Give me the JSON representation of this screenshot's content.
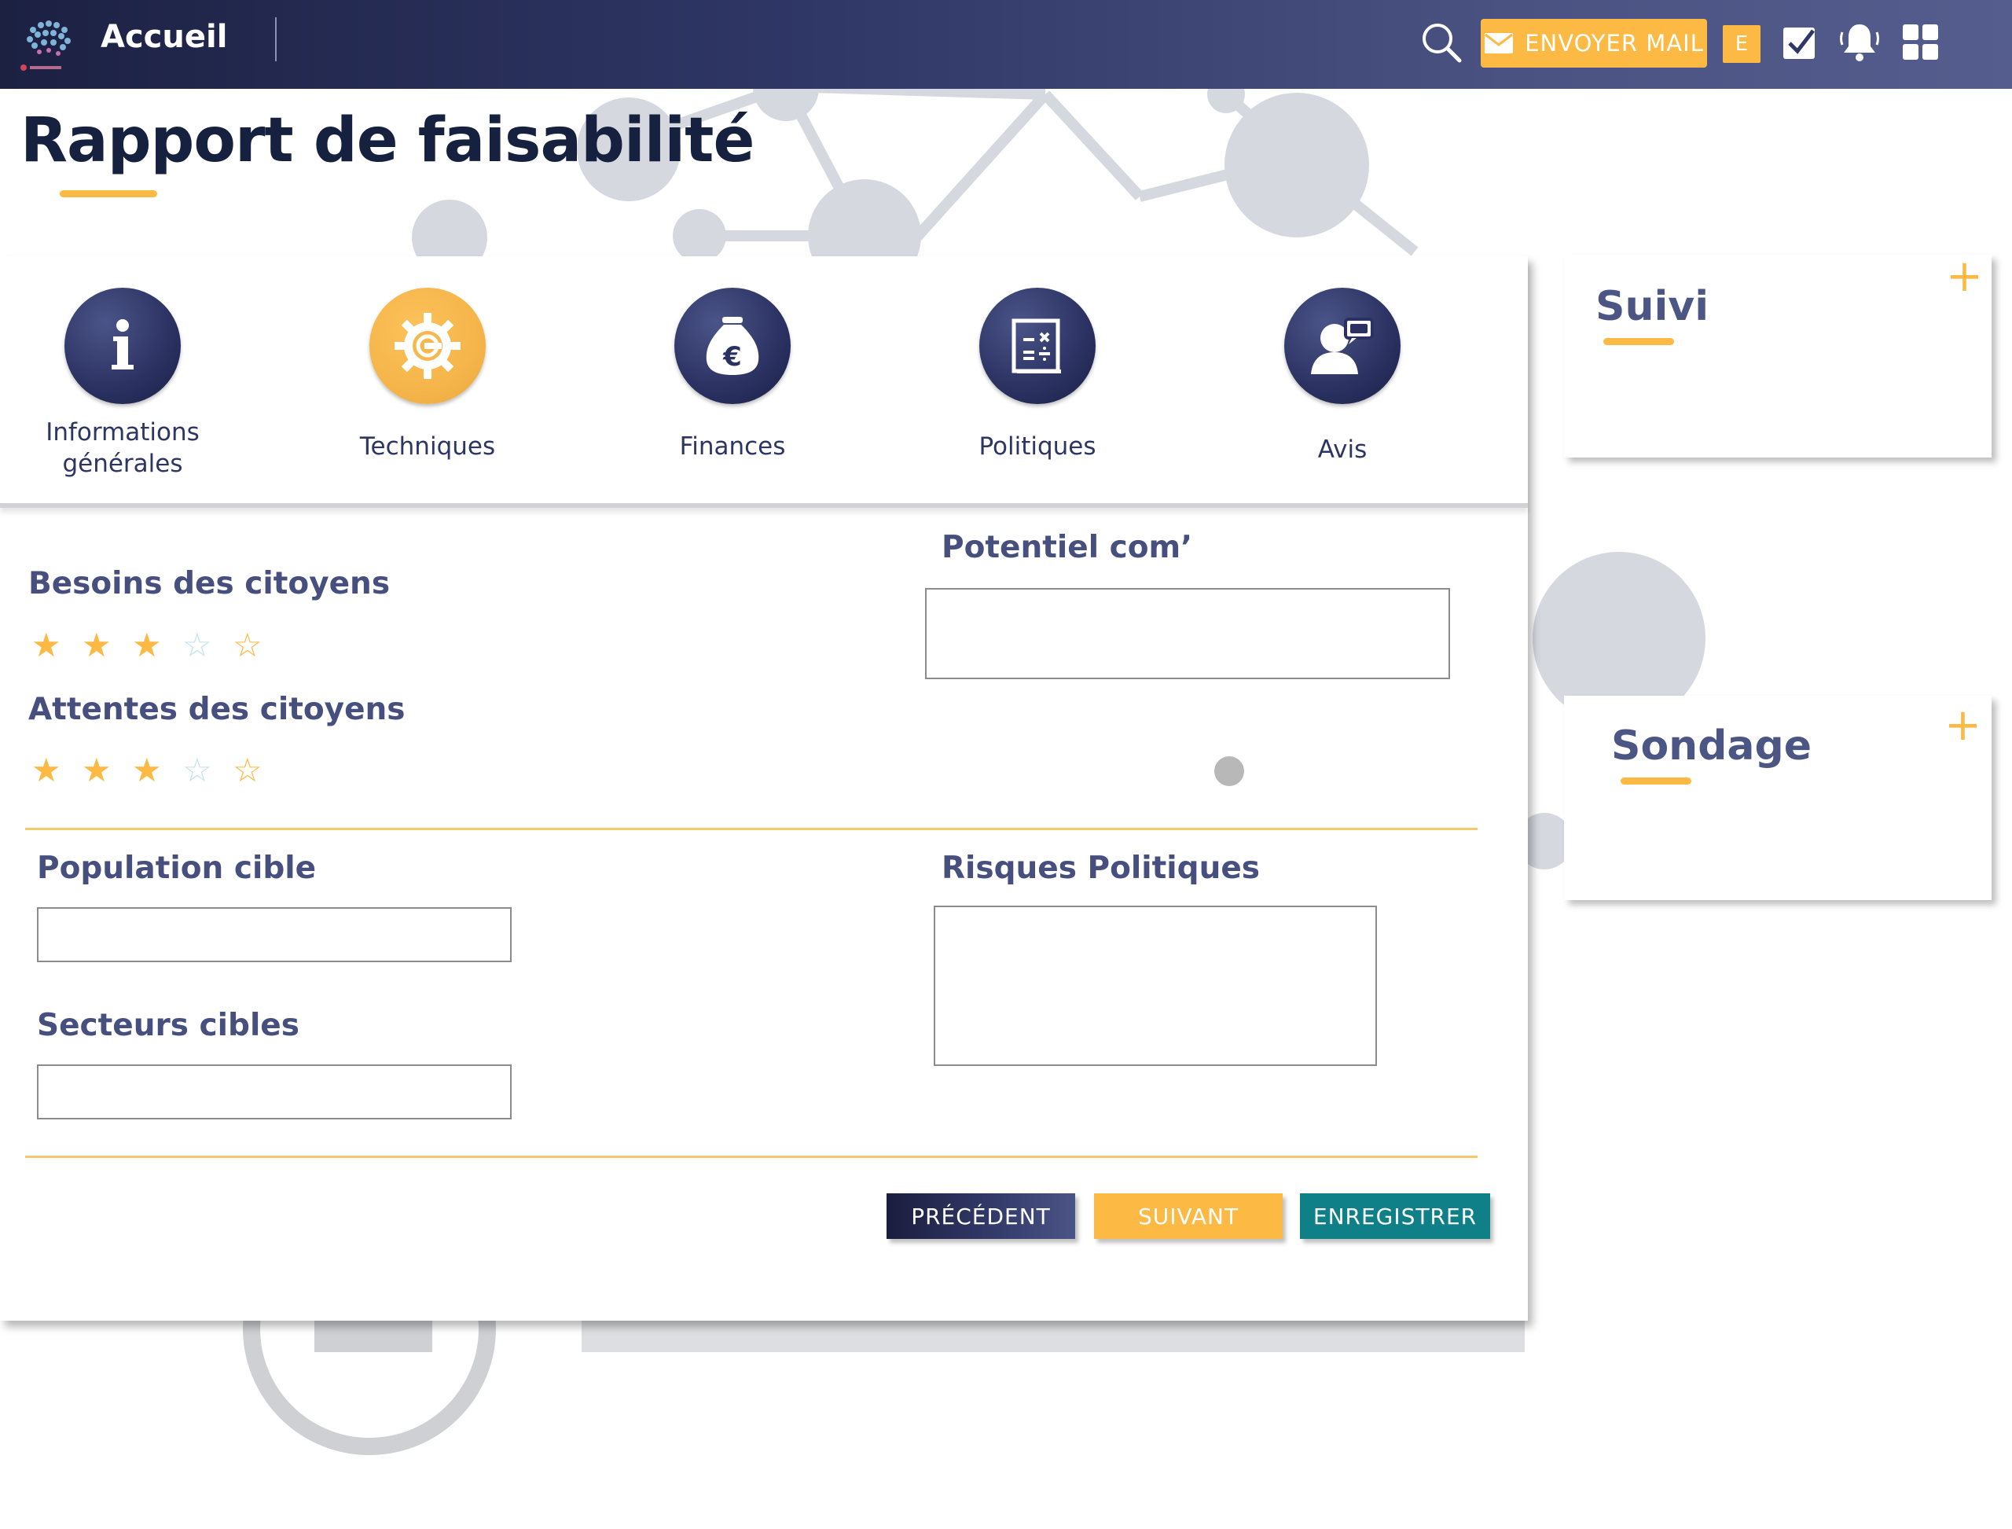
{
  "header": {
    "home_label": "Accueil",
    "mail_button": "ENVOYER  MAIL",
    "user_badge": "E"
  },
  "page": {
    "title": "Rapport de faisabilité"
  },
  "tabs": [
    {
      "label": "Informations\ngénérales",
      "icon": "info-icon",
      "active": false
    },
    {
      "label": "Techniques",
      "icon": "gear-icon",
      "active": true
    },
    {
      "label": "Finances",
      "icon": "money-bag-euro-icon",
      "active": false
    },
    {
      "label": "Politiques",
      "icon": "document-calculator-icon",
      "active": false
    },
    {
      "label": "Avis",
      "icon": "person-speech-icon",
      "active": false
    }
  ],
  "form": {
    "besoins_label": "Besoins des citoyens",
    "besoins_rating": 3,
    "attentes_label": "Attentes des citoyens",
    "attentes_rating": 3,
    "rating_max": 5,
    "potentiel_label": "Potentiel com’",
    "potentiel_value": "",
    "population_label": "Population cible",
    "population_value": "",
    "secteurs_label": "Secteurs cibles",
    "secteurs_value": "",
    "risques_label": "Risques Politiques",
    "risques_value": ""
  },
  "buttons": {
    "prev": "PRÉCÉDENT",
    "next": "SUIVANT",
    "save": "ENREGISTRER"
  },
  "side": {
    "suivi_title": "Suivi",
    "sondage_title": "Sondage",
    "add_symbol": "+"
  },
  "colors": {
    "accent": "#fcb944",
    "navy": "#2d3563",
    "teal": "#0f7f88"
  }
}
